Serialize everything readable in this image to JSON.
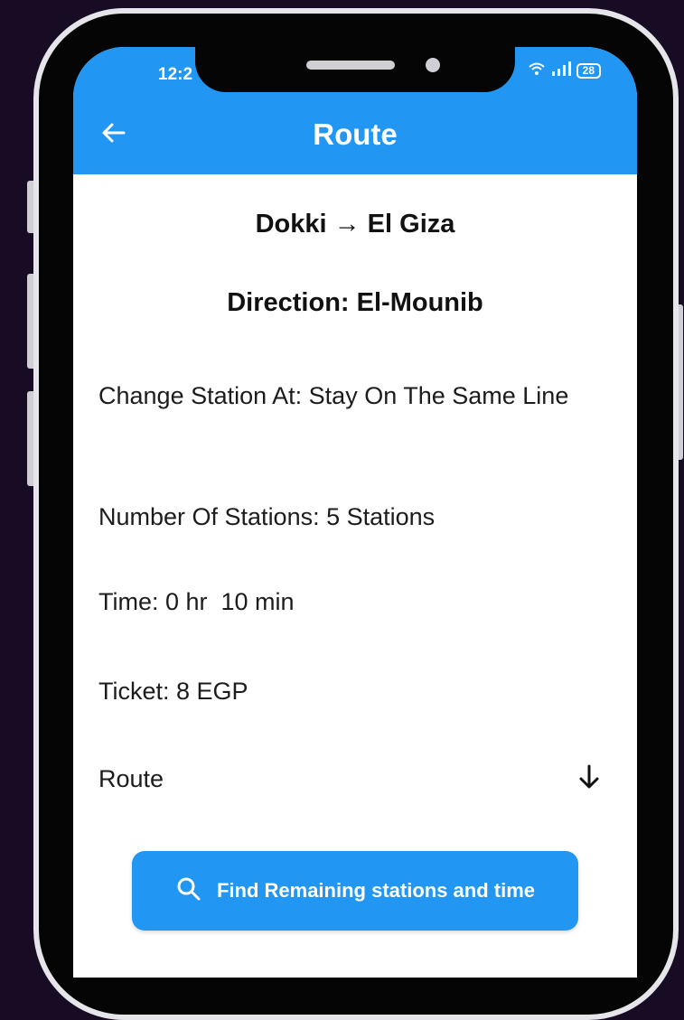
{
  "colors": {
    "background": "#170c24",
    "appbar": "#2196f3",
    "button": "#2196f3",
    "text": "#111111"
  },
  "status_bar": {
    "time": "12:2",
    "battery": "28",
    "icons": [
      "wifi-icon",
      "signal-icon",
      "battery-icon"
    ]
  },
  "appbar": {
    "title": "Route",
    "back_icon": "arrow-left-icon"
  },
  "route": {
    "heading": "Dokki → El Giza",
    "direction": "Direction: El-Mounib",
    "change_station": "Change Station At: Stay On The Same Line",
    "number_of_stations": "Number Of Stations: 5 Stations",
    "time": "Time: 0 hr  10 min",
    "ticket": "Ticket: 8 EGP",
    "route_label": "Route",
    "route_expand_icon": "arrow-down-icon"
  },
  "actions": {
    "find_button_label": "Find Remaining stations and time",
    "find_button_icon": "search-icon"
  }
}
